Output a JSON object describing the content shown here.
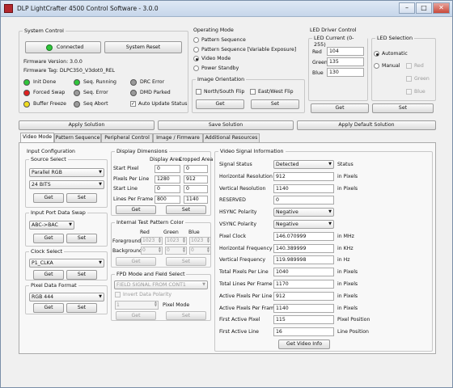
{
  "window": {
    "title": "DLP LightCrafter 4500 Control Software - 3.0.0"
  },
  "system_control": {
    "title": "System Control",
    "connected_label": "Connected",
    "reset_label": "System Reset",
    "firmware_version": "Firmware Version:  3.0.0",
    "firmware_tag": "Firmware Tag:  DLPC350_V3dot0_REL",
    "statuses": [
      {
        "label": "Init Done",
        "color": "#2fc63b"
      },
      {
        "label": "Forced Swap",
        "color": "#e02020"
      },
      {
        "label": "Buffer Freeze",
        "color": "#f0dc20"
      },
      {
        "label": "Seq. Running",
        "color": "#2fc63b"
      },
      {
        "label": "Seq. Error",
        "color": "#9a9a9a"
      },
      {
        "label": "Seq Abort",
        "color": "#9a9a9a"
      },
      {
        "label": "DRC Error",
        "color": "#9a9a9a"
      },
      {
        "label": "DMD Parked",
        "color": "#9a9a9a"
      }
    ],
    "auto_update_label": "Auto Update Status"
  },
  "operating_mode": {
    "title": "Operating Mode",
    "options": [
      "Pattern Sequence",
      "Pattern Sequence [Variable Exposure]",
      "Video Mode",
      "Power Standby"
    ],
    "selected": "Video Mode"
  },
  "image_orientation": {
    "title": "Image Orientation",
    "ns_flip": "North/South Flip",
    "ew_flip": "East/West Flip",
    "get": "Get",
    "set": "Set"
  },
  "led_driver": {
    "title": "LED Driver Control",
    "current_title": "LED Current (0-255)",
    "red_label": "Red",
    "red": "104",
    "green_label": "Green",
    "green": "135",
    "blue_label": "Blue",
    "blue": "130",
    "selection_title": "LED Selection",
    "automatic": "Automatic",
    "manual": "Manual",
    "red_chk": "Red",
    "green_chk": "Green",
    "blue_chk": "Blue",
    "get": "Get",
    "set": "Set"
  },
  "solution": {
    "apply": "Apply Solution",
    "save": "Save Solution",
    "apply_default": "Apply Default Solution"
  },
  "tabs": [
    "Video Mode",
    "Pattern Sequence",
    "Peripheral Control",
    "Image / Firmware",
    "Additional Resources"
  ],
  "input_config": {
    "title": "Input Configuration",
    "source_title": "Source Select",
    "source_value": "Parallel RGB",
    "bits_value": "24 BITS",
    "port_swap_title": "Input Port Data Swap",
    "port_swap_value": "ABC->BAC",
    "clock_title": "Clock Select",
    "clock_value": "P1_CLKA",
    "pixel_format_title": "Pixel Data Format",
    "pixel_format_value": "RGB 444",
    "get": "Get",
    "set": "Set"
  },
  "display_dims": {
    "title": "Display Dimensions",
    "display_area": "Display Area",
    "cropped_area": "Cropped Area",
    "rows": [
      {
        "label": "Start Pixel",
        "display": "0",
        "cropped": "0"
      },
      {
        "label": "Pixels Per Line",
        "display": "1280",
        "cropped": "912"
      },
      {
        "label": "Start Line",
        "display": "0",
        "cropped": "0"
      },
      {
        "label": "Lines Per Frame",
        "display": "800",
        "cropped": "1140"
      }
    ],
    "get": "Get",
    "set": "Set"
  },
  "test_pattern": {
    "title": "Internal Test Pattern Color",
    "red": "Red",
    "green": "Green",
    "blue": "Blue",
    "foreground": "Foreground",
    "background": "Background",
    "fg_values": [
      "1023",
      "1023",
      "1023"
    ],
    "bg_values": [
      "0",
      "0",
      "0"
    ],
    "get": "Get",
    "set": "Set"
  },
  "fpd_mode": {
    "title": "FPD Mode and Field Select",
    "field_value": "FIELD SIGNAL FROM CONT1",
    "invert_label": "Invert Data Polarity",
    "pixel_mode_value": "1",
    "pixel_mode_label": "Pixel Mode",
    "get": "Get",
    "set": "Set"
  },
  "video_signal": {
    "title": "Video Signal Information",
    "rows": [
      {
        "label": "Signal Status",
        "value": "Detected",
        "unit": "Status",
        "type": "select"
      },
      {
        "label": "Horizontal Resolution",
        "value": "912",
        "unit": "in Pixels",
        "type": "input"
      },
      {
        "label": "Vertical Resolution",
        "value": "1140",
        "unit": "in Pixels",
        "type": "input"
      },
      {
        "label": "RESERVED",
        "value": "0",
        "unit": "",
        "type": "input"
      },
      {
        "label": "HSYNC Polarity",
        "value": "Negative",
        "unit": "",
        "type": "select"
      },
      {
        "label": "VSYNC Polarity",
        "value": "Negative",
        "unit": "",
        "type": "select"
      },
      {
        "label": "Pixel Clock",
        "value": "146.070999",
        "unit": "in MHz",
        "type": "input"
      },
      {
        "label": "Horizontal Frequency",
        "value": "140.389999",
        "unit": "in KHz",
        "type": "input"
      },
      {
        "label": "Vertical Frequency",
        "value": "119.989998",
        "unit": "in Hz",
        "type": "input"
      },
      {
        "label": "Total Pixels Per Line",
        "value": "1040",
        "unit": "in Pixels",
        "type": "input"
      },
      {
        "label": "Total Lines Per Frame",
        "value": "1170",
        "unit": "in Pixels",
        "type": "input"
      },
      {
        "label": "Active Pixels Per Line",
        "value": "912",
        "unit": "in Pixels",
        "type": "input"
      },
      {
        "label": "Active Pixels Per Frame",
        "value": "1140",
        "unit": "in Pixels",
        "type": "input"
      },
      {
        "label": "First Active Pixel",
        "value": "115",
        "unit": "Pixel Position",
        "type": "input"
      },
      {
        "label": "First Active Line",
        "value": "16",
        "unit": "Line Position",
        "type": "input"
      }
    ],
    "get_button": "Get Video Info"
  }
}
